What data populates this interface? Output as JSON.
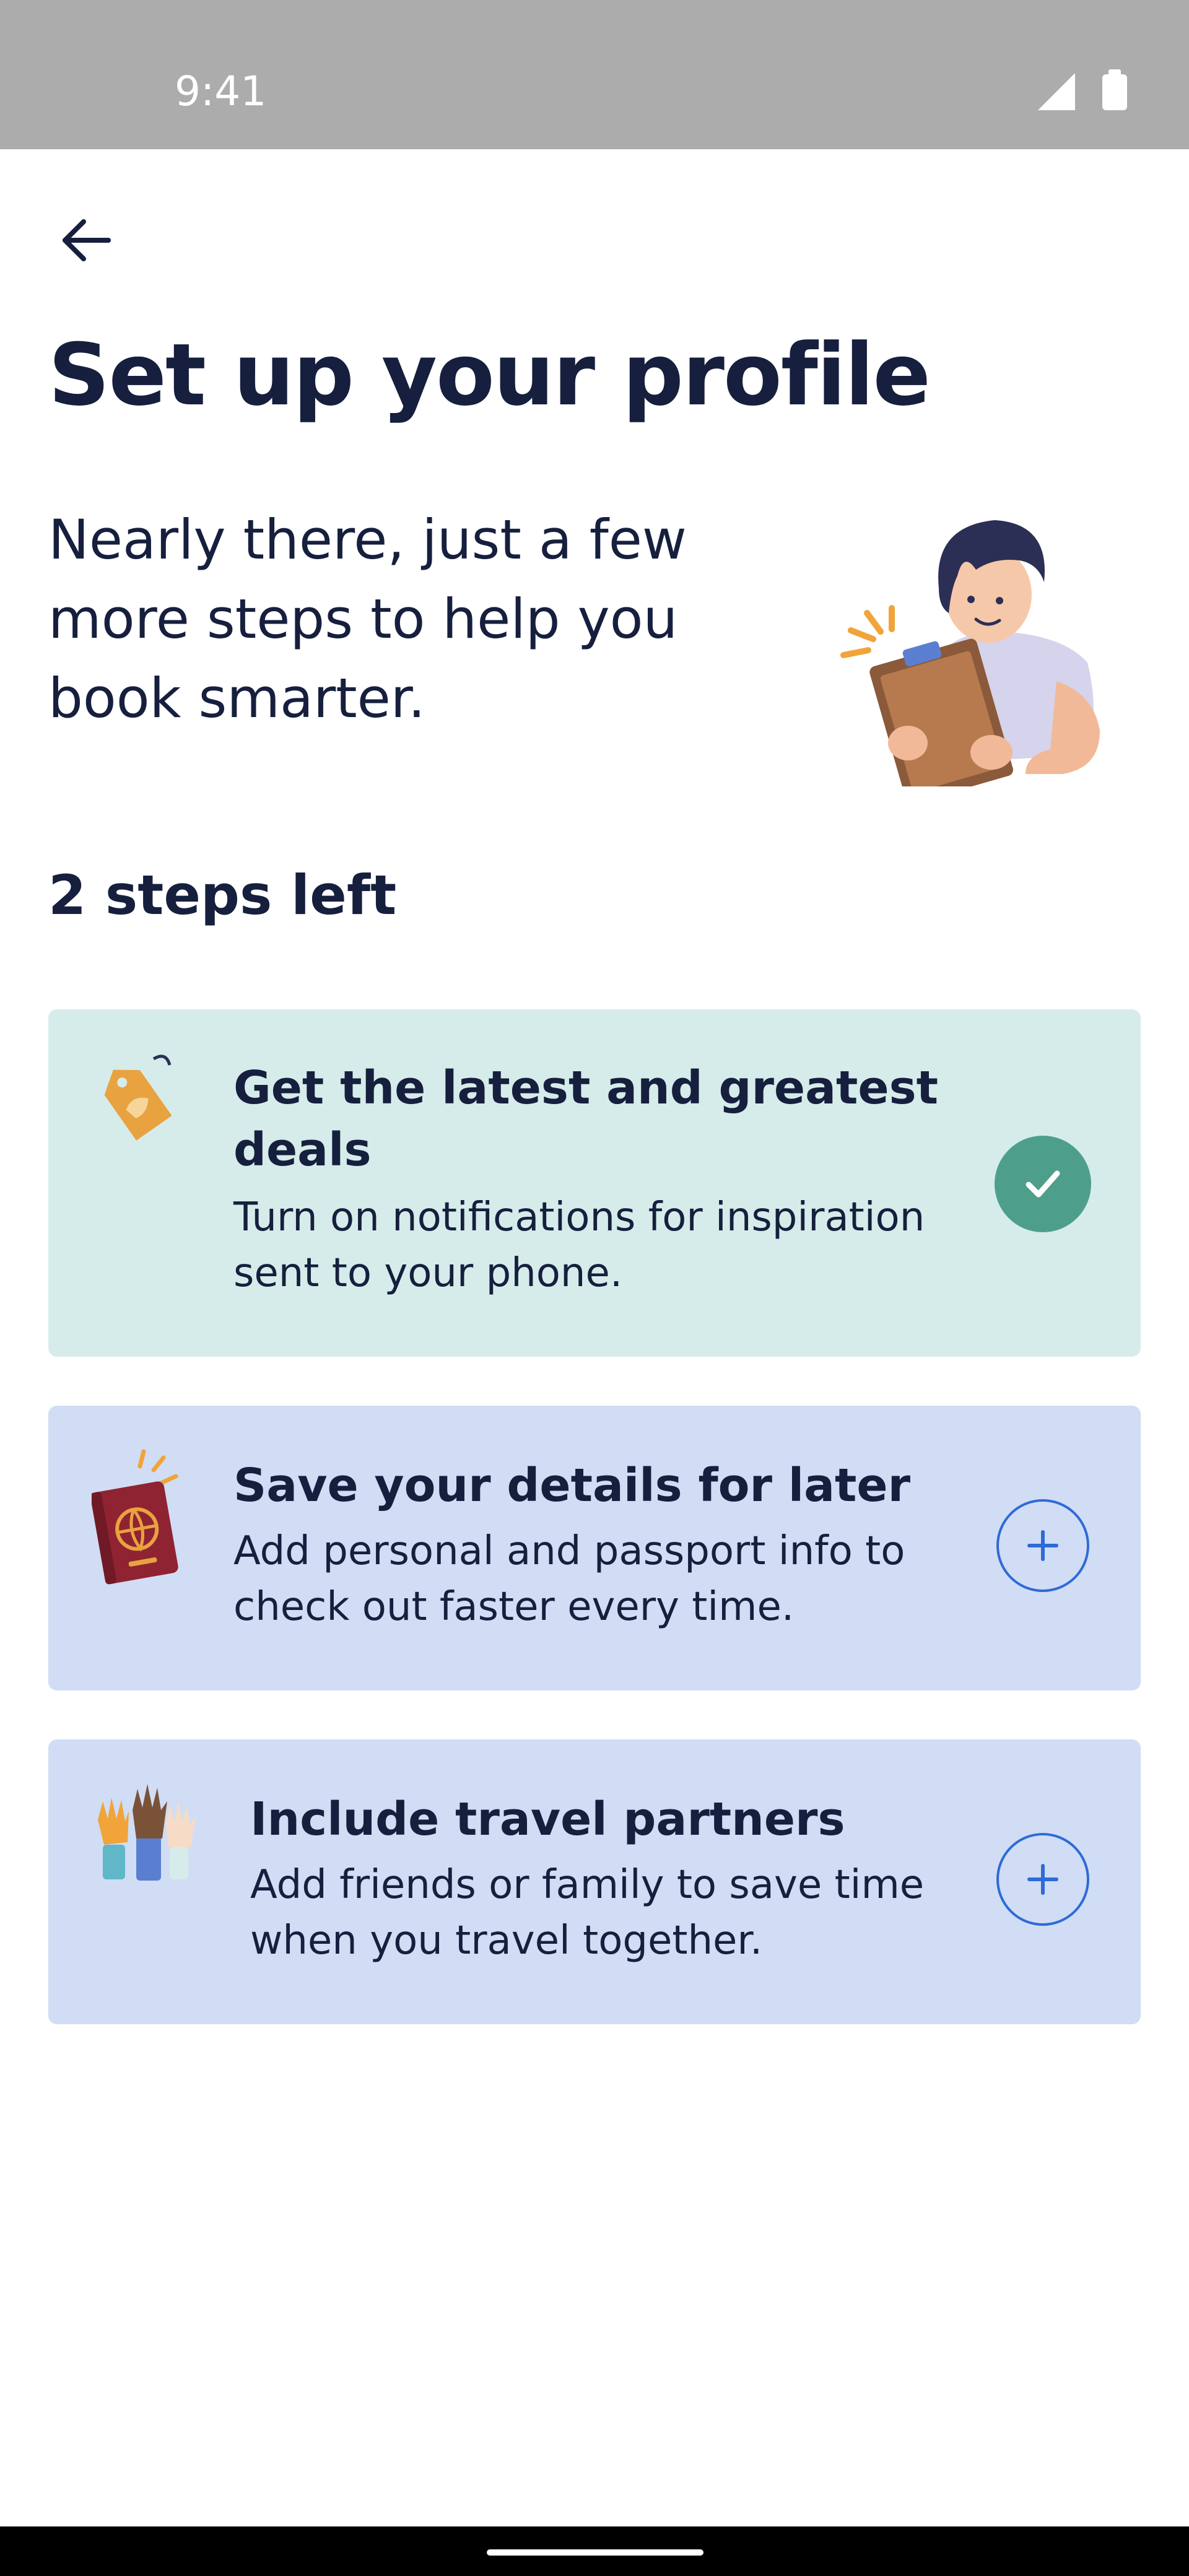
{
  "status_bar": {
    "time": "9:41"
  },
  "header": {
    "back_icon": "arrow-left-icon",
    "title": "Set up your profile",
    "subtitle": "Nearly there, just a few more steps to help you book smarter."
  },
  "progress": {
    "label": "2 steps left"
  },
  "steps": [
    {
      "title_line1": "Get the latest and greatest",
      "title_line2": "deals",
      "desc_line1": "Turn on notifications for inspiration",
      "desc_line2": "sent to your phone.",
      "icon": "price-tag-icon",
      "status": "completed",
      "status_icon": "check-icon"
    },
    {
      "title_line1": "Save your details for later",
      "desc_line1": "Add personal and passport info to",
      "desc_line2": "check out faster every time.",
      "icon": "passport-icon",
      "status": "add",
      "status_icon": "plus-icon"
    },
    {
      "title_line1": "Include travel partners",
      "desc_line1": "Add friends or family to save time",
      "desc_line2": "when you travel together.",
      "icon": "raised-hands-icon",
      "status": "add",
      "status_icon": "plus-icon"
    }
  ],
  "colors": {
    "text": "#161f3d",
    "completed_card": "#d6ecea",
    "todo_card": "#d0ddf4",
    "check_badge": "#4d9f8c",
    "accent_blue": "#2f6ad6",
    "status_bar": "#acacac"
  }
}
